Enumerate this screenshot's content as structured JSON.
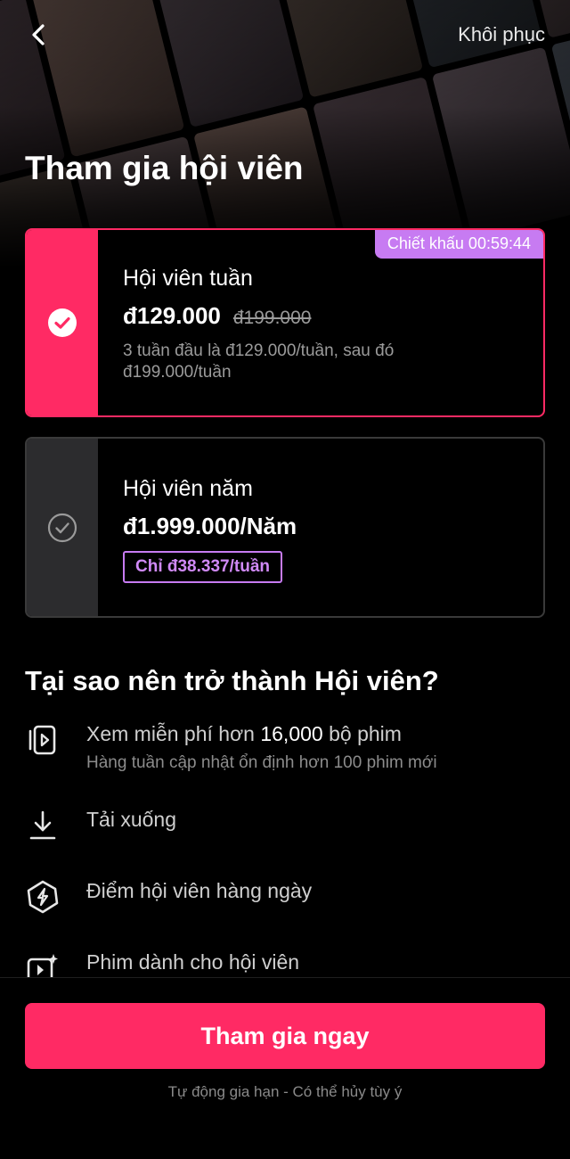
{
  "header": {
    "back_icon": "chevron-left-icon",
    "restore_label": "Khôi phục"
  },
  "title": "Tham gia hội viên",
  "plans": [
    {
      "name": "Hội viên tuần",
      "price": "đ129.000",
      "old_price": "đ199.000",
      "description": "3 tuần đầu là đ129.000/tuần, sau đó đ199.000/tuần",
      "badge": "Chiết khấu 00:59:44",
      "selected": true,
      "icon": "check-circle-filled-icon"
    },
    {
      "name": "Hội viên năm",
      "price": "đ1.999.000/Năm",
      "per_week": "Chỉ đ38.337/tuần",
      "selected": false,
      "icon": "check-circle-outline-icon"
    }
  ],
  "why": {
    "title": "Tại sao nên trở thành Hội viên?",
    "features": [
      {
        "icon": "video-library-icon",
        "title_prefix": "Xem miễn phí hơn ",
        "title_highlight": "16,000",
        "title_suffix": " bộ phim",
        "subtitle": "Hàng tuần cập nhật ổn định hơn 100 phim mới"
      },
      {
        "icon": "download-icon",
        "title": "Tải xuống"
      },
      {
        "icon": "lightning-badge-icon",
        "title": "Điểm hội viên hàng ngày"
      },
      {
        "icon": "sparkle-video-icon",
        "title": "Phim dành cho hội viên"
      }
    ]
  },
  "footer": {
    "join_label": "Tham gia ngay",
    "renew_note": "Tự động gia hạn - Có thể hủy tùy ý"
  },
  "colors": {
    "accent": "#ff2a64",
    "badge": "#c77bf2",
    "background": "#000000"
  }
}
